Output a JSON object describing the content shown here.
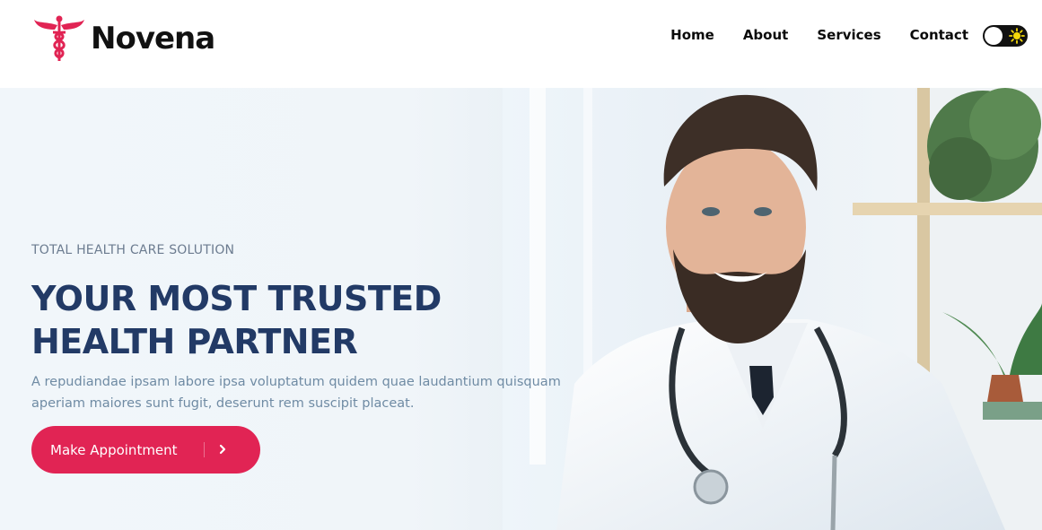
{
  "brand": {
    "name": "Novena",
    "logo_icon": "caduceus-icon",
    "color": "#e12454"
  },
  "nav": {
    "items": [
      "Home",
      "About",
      "Services",
      "Contact"
    ]
  },
  "theme_toggle": {
    "icon": "sun-icon",
    "state": "light"
  },
  "hero": {
    "eyebrow": "TOTAL HEALTH CARE SOLUTION",
    "headline_line1": "YOUR MOST TRUSTED",
    "headline_line2": "HEALTH PARTNER",
    "paragraph_line1": "A repudiandae ipsam labore ipsa voluptatum quidem quae laudantium quisquam",
    "paragraph_line2": "aperiam maiores sunt fugit, deserunt rem suscipit placeat.",
    "cta_label": "Make Appointment",
    "cta_icon": "chevron-right-icon",
    "headline_color": "#223a66",
    "text_color": "#6f8ba4"
  }
}
